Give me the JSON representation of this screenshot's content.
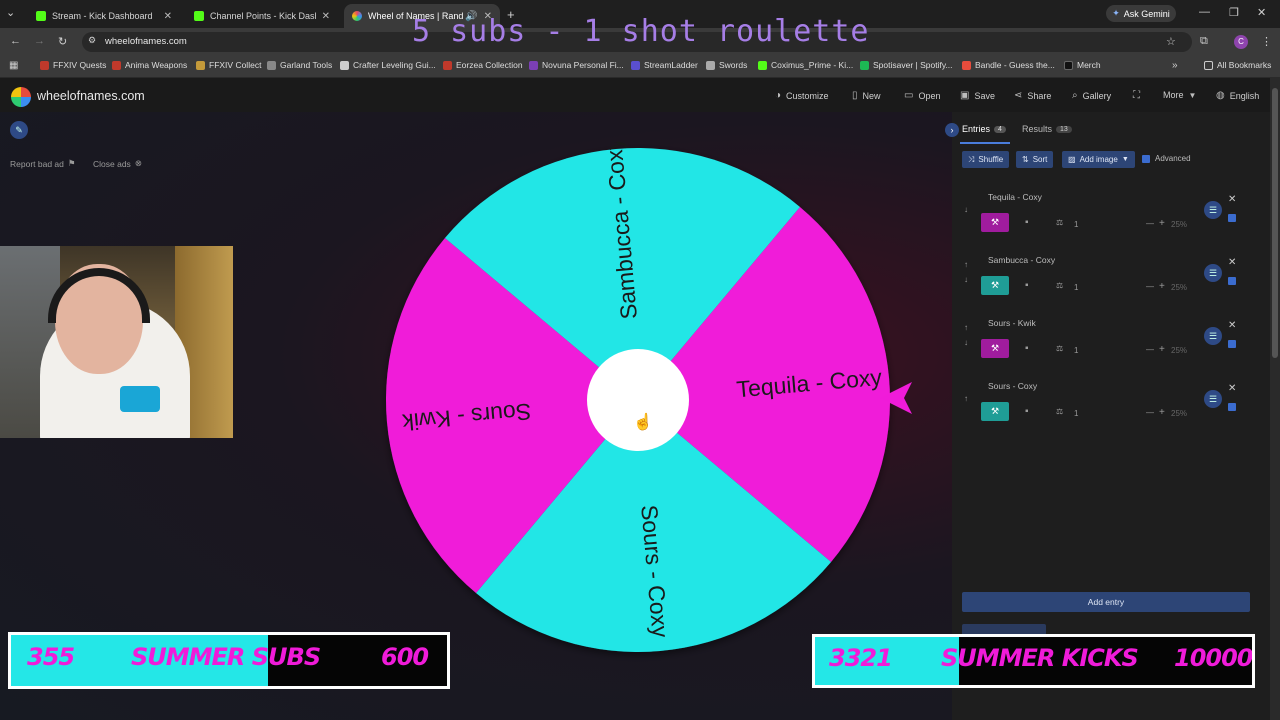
{
  "browser": {
    "tabs": [
      {
        "title": "Stream - Kick Dashboard",
        "active": false,
        "color": "#53fc18"
      },
      {
        "title": "Channel Points - Kick Dashboard",
        "active": false,
        "color": "#53fc18"
      },
      {
        "title": "Wheel of Names | Random",
        "active": true,
        "color": "#e84a5f"
      }
    ],
    "ask_gemini": "Ask Gemini",
    "url": "wheelofnames.com",
    "bookmarks": [
      {
        "label": "FFXIV Quests",
        "color": "#c0392b"
      },
      {
        "label": "Anima Weapons",
        "color": "#c0392b"
      },
      {
        "label": "FFXIV Collect",
        "color": "#c49a3a"
      },
      {
        "label": "Garland Tools",
        "color": "#888888"
      },
      {
        "label": "Crafter Leveling Gui...",
        "color": "#cccccc"
      },
      {
        "label": "Eorzea Collection",
        "color": "#c0392b"
      },
      {
        "label": "Novuna Personal Fi...",
        "color": "#7b3fb5"
      },
      {
        "label": "StreamLadder",
        "color": "#5a4fcf"
      },
      {
        "label": "Swords",
        "color": "#aaaaaa"
      },
      {
        "label": "Coximus_Prime - Ki...",
        "color": "#53fc18"
      },
      {
        "label": "Spotisaver | Spotify...",
        "color": "#1db954"
      },
      {
        "label": "Bandle - Guess the...",
        "color": "#e74c3c"
      },
      {
        "label": "Merch",
        "color": "#111111"
      }
    ],
    "all_bookmarks": "All Bookmarks"
  },
  "overlay_title": "5 subs - 1 shot roulette",
  "site": {
    "logo_text": "wheelofnames.com",
    "menu": [
      "Customize",
      "New",
      "Open",
      "Save",
      "Share",
      "Gallery",
      "More",
      "English"
    ],
    "report_ad": "Report bad ad",
    "close_ads": "Close ads"
  },
  "wheel": {
    "slices": [
      {
        "label": "Tequila - Coxy",
        "color": "#f01bd9"
      },
      {
        "label": "Sours - Coxy",
        "color": "#22e6e6"
      },
      {
        "label": "Sours - Kwik",
        "color": "#f01bd9"
      },
      {
        "label": "Sambucca - Coxy",
        "color": "#22e6e6"
      }
    ],
    "pointer_color": "#f01bd9"
  },
  "panel": {
    "tabs": [
      {
        "label": "Entries",
        "count": "4"
      },
      {
        "label": "Results",
        "count": "13"
      }
    ],
    "shuffle": "Shuffle",
    "sort": "Sort",
    "add_image": "Add image",
    "advanced": "Advanced",
    "entries": [
      {
        "name": "Tequila - Coxy",
        "color": "#a01c9e",
        "weight": "1",
        "percent": "25%"
      },
      {
        "name": "Sambucca - Coxy",
        "color": "#1f9d96",
        "weight": "1",
        "percent": "25%"
      },
      {
        "name": "Sours - Kwik",
        "color": "#a01c9e",
        "weight": "1",
        "percent": "25%"
      },
      {
        "name": "Sours - Coxy",
        "color": "#1f9d96",
        "weight": "1",
        "percent": "25%"
      }
    ],
    "add_entry": "Add entry"
  },
  "bars": {
    "subs": {
      "current": "355",
      "label": "SUMMER SUBS",
      "goal": "600",
      "progress": 0.59
    },
    "kicks": {
      "current": "3321",
      "label": "SUMMER KICKS",
      "goal": "10000",
      "progress": 0.33
    }
  }
}
